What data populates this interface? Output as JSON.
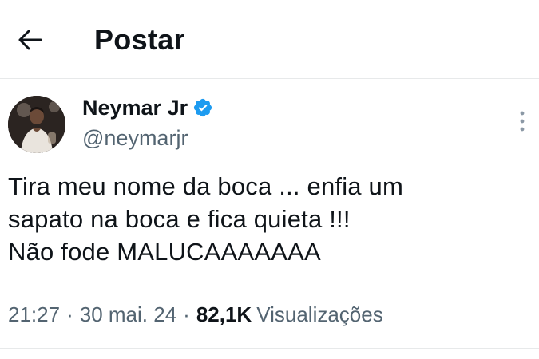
{
  "header": {
    "title": "Postar",
    "back_icon": "arrow-left-icon"
  },
  "tweet": {
    "author": {
      "display_name": "Neymar Jr",
      "handle": "@neymarjr",
      "verified": true,
      "verified_color": "#1d9bf0"
    },
    "text": "Tira meu nome da boca ... enfia um\nsapato na boca e fica quieta !!!\nNão fode MALUCAAAAAAA",
    "time": "21:27",
    "separator": "·",
    "date": "30 mai. 24",
    "views_count": "82,1K",
    "views_label": "Visualizações",
    "more_icon": "more-vertical-icon"
  },
  "colors": {
    "text_primary": "#0f1419",
    "text_secondary": "#536471",
    "divider": "#e7e9ea",
    "background": "#ffffff"
  }
}
